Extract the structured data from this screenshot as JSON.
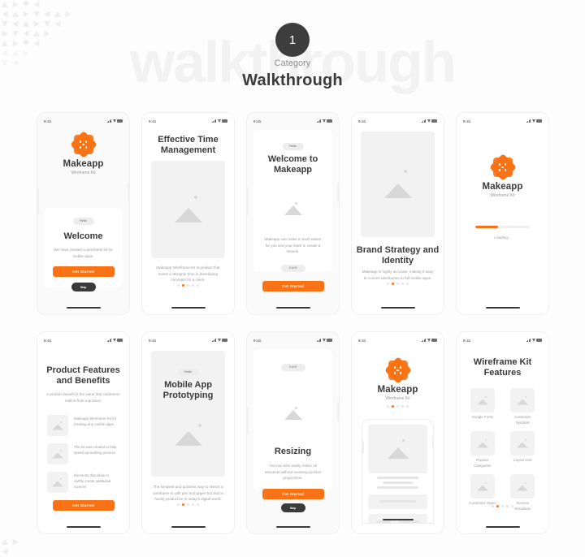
{
  "header": {
    "watermark": "walkthrough",
    "number": "1",
    "category_label": "Category",
    "title": "Walkthrough"
  },
  "status_bar": {
    "time": "9:41"
  },
  "brand": {
    "name": "Makeapp",
    "subtitle": "Wireframe Kit"
  },
  "colors": {
    "accent": "#f97316",
    "dark": "#3a3a3a",
    "muted": "#9b9b9b",
    "placeholder": "#f2f2f2",
    "page_bg": "#fdfdfd",
    "watermark": "#f2f2f2"
  },
  "screens": [
    {
      "id": "welcome",
      "pill": "Hello",
      "title": "Welcome",
      "body": "We have created a wireframe kit for mobile apps.",
      "cta": "Get Started",
      "skip": "Skip"
    },
    {
      "id": "effective-time-management",
      "title": "Effective Time Management",
      "body": "Makeapp Wireframe Kit is product that saves a designer time in developing concepts for a client.",
      "dots": {
        "count": 5,
        "active": 1
      }
    },
    {
      "id": "welcome-to-makeapp",
      "pill": "Hello",
      "title": "Welcome to Makeapp",
      "body": "Makeapp can make it much easier for you and your team to create a miracle.",
      "step_pill": "3 of 5",
      "cta": "Get Started"
    },
    {
      "id": "brand-strategy-and-identity",
      "title": "Brand Strategy and Identity",
      "body": "Makeapp is highly accurate, making it easy to convert wireframes to full mobile apps.",
      "dots": {
        "count": 5,
        "active": 1
      }
    },
    {
      "id": "loading",
      "loading_label": "Loading...",
      "progress_percent": 42
    },
    {
      "id": "product-features-and-benefits",
      "title": "Product Features and Benefits",
      "body": "A product benefit is the value that customers realize from a product.",
      "features": [
        "Makeapp Wireframe Kit for creating any mobile apps",
        "The kit was created to help speed up working process",
        "Elements that allow to swiftly create additional screens"
      ],
      "cta": "Get Started"
    },
    {
      "id": "mobile-app-prototyping",
      "pill": "Hello",
      "title": "Mobile App Prototyping",
      "body": "The simplest and quickest way to sketch a wireframe is with pen and paper but that is hardly productive in today's digital world.",
      "dots": {
        "count": 5,
        "active": 1
      }
    },
    {
      "id": "resizing",
      "step_pill": "3 of 5",
      "title": "Resizing",
      "body": "You can also easily resize all elements without messing up their proportions.",
      "cta": "Get Started",
      "skip": "Skip"
    },
    {
      "id": "makeapp-preview",
      "dots": {
        "count": 5,
        "active": 1
      }
    },
    {
      "id": "wireframe-kit-features",
      "title": "Wireframe Kit Features",
      "features": [
        "Google Fonts",
        "Customize Symbols",
        "Popular Categories",
        "Layout Grid",
        "Customize Styles",
        "Screens Templates"
      ],
      "dots": {
        "count": 5,
        "active": 1
      }
    }
  ]
}
